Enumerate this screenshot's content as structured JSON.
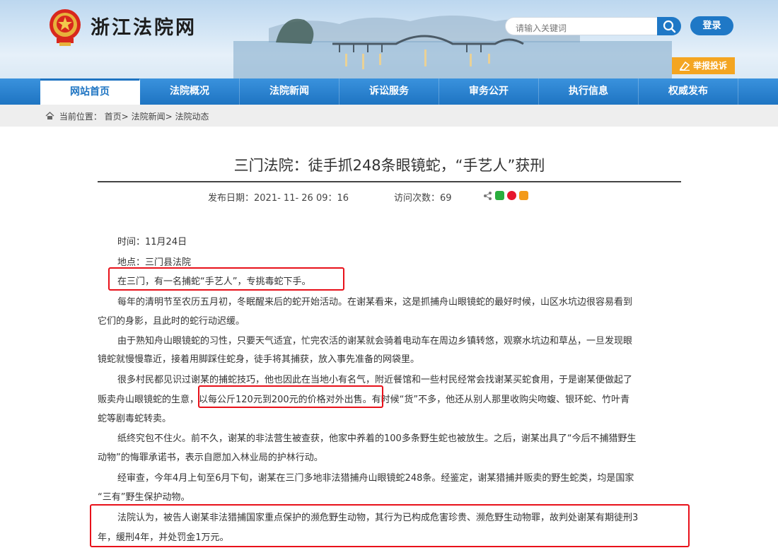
{
  "site": {
    "title": "浙江法院网"
  },
  "search": {
    "placeholder": "请输入关键词"
  },
  "header": {
    "login_label": "登录",
    "report_label": "举报投诉"
  },
  "nav": {
    "items": [
      {
        "label": "网站首页",
        "active": true
      },
      {
        "label": "法院概况"
      },
      {
        "label": "法院新闻"
      },
      {
        "label": "诉讼服务"
      },
      {
        "label": "审务公开"
      },
      {
        "label": "执行信息"
      },
      {
        "label": "权威发布"
      }
    ]
  },
  "breadcrumb": {
    "label": "当前位置：",
    "items": [
      "首页>",
      "法院新闻>",
      "法院动态"
    ]
  },
  "article": {
    "title": "三门法院：徒手抓248条眼镜蛇，“手艺人”获刑",
    "date_label": "发布日期：",
    "date": "2021- 11- 26 09：16",
    "visits_label": "访问次数：",
    "visits": "69",
    "lines": [
      "时间：11月24日",
      "地点：三门县法院",
      "在三门，有一名捕蛇“手艺人”，专挑毒蛇下手。",
      "每年的清明节至农历五月初，冬眠醒来后的蛇开始活动。在谢某看来，这是抓捕舟山眼镜蛇的最好时候，山区水坑边很容易看到",
      "它们的身影，且此时的蛇行动迟缓。",
      "由于熟知舟山眼镜蛇的习性，只要天气适宜，忙完农活的谢某就会骑着电动车在周边乡镇转悠，观察水坑边和草丛，一旦发现眼",
      "镜蛇就慢慢靠近，接着用脚踩住蛇身，徒手将其捕获，放入事先准备的网袋里。",
      "很多村民都见识过谢某的捕蛇技巧，他也因此在当地小有名气，附近餐馆和一些村民经常会找谢某买蛇食用，于是谢某便做起了",
      "贩卖舟山眼镜蛇的生意，以每公斤120元到200元的价格对外出售。有时候“货”不多，他还从别人那里收购尖吻蝮、银环蛇、竹叶青",
      "蛇等剧毒蛇转卖。",
      "纸终究包不住火。前不久，谢某的非法营生被查获，他家中养着的100多条野生蛇也被放生。之后，谢某出具了“今后不捕猎野生",
      "动物”的悔罪承诺书，表示自愿加入林业局的护林行动。",
      "经审查，今年4月上旬至6月下旬，谢某在三门多地非法猎捕舟山眼镜蛇248条。经鉴定，谢某猎捕并贩卖的野生蛇类，均是国家",
      "“三有”野生保护动物。",
      "法院认为，被告人谢某非法猎捕国家重点保护的濒危野生动物，其行为已构成危害珍贵、濒危野生动物罪，故判处谢某有期徒刑3",
      "年，缓刑4年，并处罚金1万元。"
    ]
  },
  "colors": {
    "nav_blue": "#1e74c2",
    "report_orange": "#f4a521",
    "highlight_red": "#e8111a"
  },
  "icons": [
    "emblem-icon",
    "search-icon",
    "report-icon",
    "home-icon",
    "share-icon",
    "wechat-icon",
    "weibo-icon",
    "add-icon"
  ]
}
